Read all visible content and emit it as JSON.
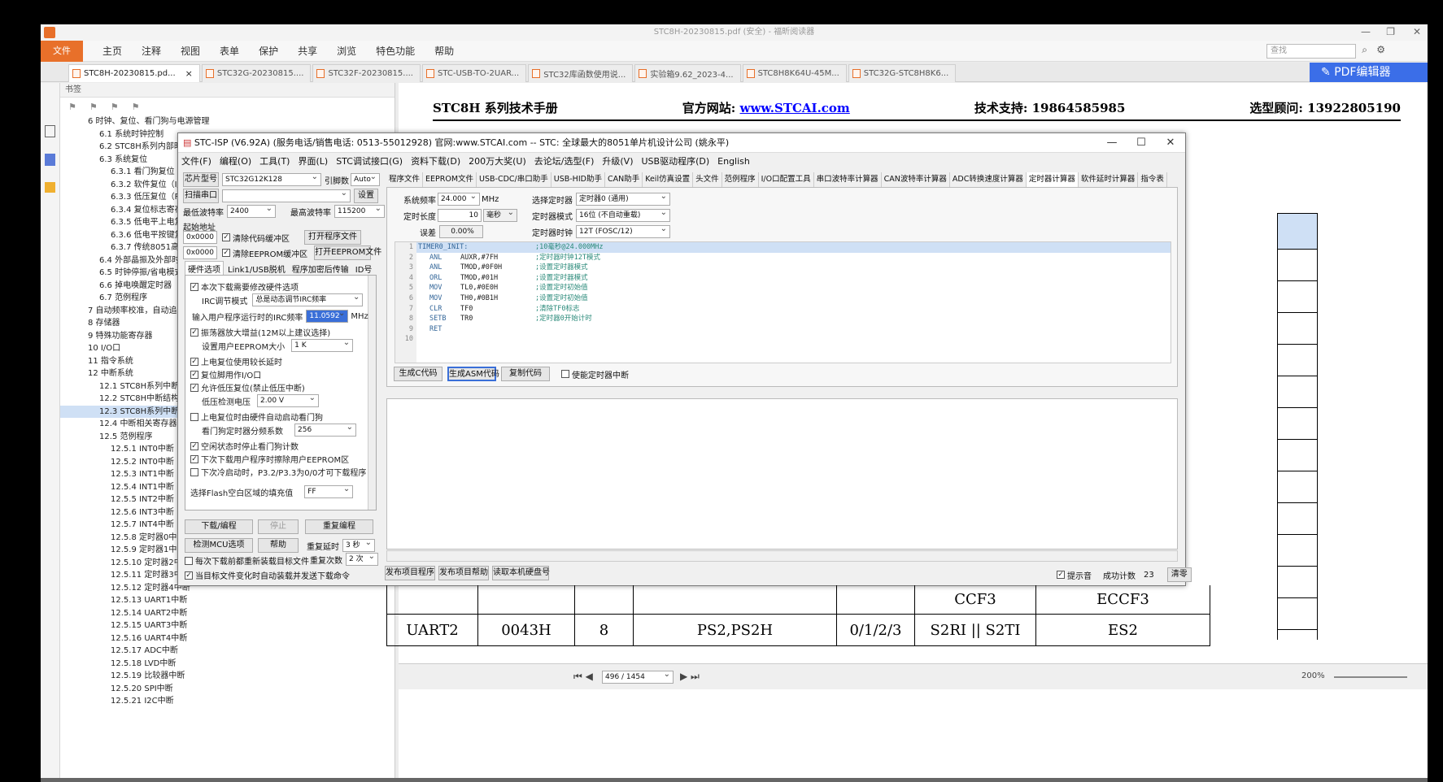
{
  "pdf": {
    "window_title": "STC8H-20230815.pdf (安全) - 福昕阅读器",
    "file_tab": "文件",
    "menu": [
      "主页",
      "注释",
      "视图",
      "表单",
      "保护",
      "共享",
      "浏览",
      "特色功能",
      "帮助"
    ],
    "search_placeholder": "查找",
    "pdf_editor": "PDF编辑器",
    "tabs": [
      "STC8H-20230815.pd...",
      "STC32G-20230815....",
      "STC32F-20230815....",
      "STC-USB-TO-2UAR...",
      "STC32库函数使用说...",
      "实验箱9.62_2023-4...",
      "STC8H8K64U-45M...",
      "STC32G-STC8H8K6..."
    ],
    "bookmarks_label": "书签",
    "tree": [
      "6 时钟、复位、看门狗与电源管理",
      "6.1 系统时钟控制",
      "6.2 STC8H系列内部时",
      "6.3 系统复位",
      "6.3.1 看门狗复位（",
      "6.3.2 软件复位（I/A",
      "6.3.3 低压复位（R",
      "6.3.4 复位标志寄存",
      "6.3.5 低电平上电复",
      "6.3.6 低电平按键复",
      "6.3.7 传统8051高电",
      "6.4 外部晶振及外部时",
      "6.5 时钟停振/省电模式",
      "6.6 掉电唤醒定时器",
      "6.7 范例程序",
      "7 自动频率校准，自动追频",
      "8 存储器",
      "9 特殊功能寄存器",
      "10 I/O口",
      "11 指令系统",
      "12 中断系统",
      "12.1 STC8H系列中断源",
      "12.2 STC8H中断结构图",
      "12.3 STC8H系列中断列",
      "12.4 中断相关寄存器",
      "12.5 范例程序",
      "12.5.1 INT0中断（上",
      "12.5.2 INT0中断（下",
      "12.5.3 INT1中断（上",
      "12.5.4 INT1中断（下",
      "12.5.5 INT2中断（下",
      "12.5.6 INT3中断（下",
      "12.5.7 INT4中断（下",
      "12.5.8 定时器0中断",
      "12.5.9 定时器1中断",
      "12.5.10 定时器2中断",
      "12.5.11 定时器3中断",
      "12.5.12 定时器4中断",
      "12.5.13 UART1中断",
      "12.5.14 UART2中断",
      "12.5.15 UART3中断",
      "12.5.16 UART4中断",
      "12.5.17 ADC中断",
      "12.5.18 LVD中断",
      "12.5.19 比较器中断",
      "12.5.20 SPI中断",
      "12.5.21 I2C中断"
    ],
    "doc_header": {
      "title": "STC8H 系列技术手册",
      "site_label": "官方网站: ",
      "site": "www.STCAI.com",
      "support": "技术支持: 19864585985",
      "advisor": "选型顾问: 13922805190"
    },
    "table": {
      "r1": [
        "CCF3",
        "ECCF3"
      ],
      "r2": [
        "UART2",
        "0043H",
        "8",
        "PS2,PS2H",
        "0/1/2/3",
        "S2RI || S2TI",
        "ES2"
      ]
    },
    "page": "496 / 1454",
    "zoom": "200%"
  },
  "isp": {
    "title": "STC-ISP (V6.92A) (服务电话/销售电话: 0513-55012928) 官网:www.STCAI.com  -- STC: 全球最大的8051单片机设计公司 (姚永平)",
    "menu": [
      "文件(F)",
      "编程(O)",
      "工具(T)",
      "界面(L)",
      "STC调试接口(G)",
      "资料下载(D)",
      "200万大奖(U)",
      "去论坛/选型(F)",
      "升级(V)",
      "USB驱动程序(D)",
      "English"
    ],
    "chip_label": "芯片型号",
    "chip": "STC32G12K128",
    "pins_label": "引脚数",
    "pins": "Auto",
    "scan_btn": "扫描串口",
    "settings_btn": "设置",
    "min_baud_label": "最低波特率",
    "min_baud": "2400",
    "max_baud_label": "最高波特率",
    "max_baud": "115200",
    "start_addr_label": "起始地址",
    "addr1": "0x0000",
    "clear_code": "清除代码缓冲区",
    "open_prog": "打开程序文件",
    "addr2": "0x0000",
    "clear_eeprom": "清除EEPROM缓冲区",
    "open_eeprom": "打开EEPROM文件",
    "left_tabs": [
      "硬件选项",
      "Link1/USB脱机",
      "程序加密后传输",
      "ID号"
    ],
    "opt_modify": "本次下载需要修改硬件选项",
    "irc_mode_label": "IRC调节模式",
    "irc_mode": "总是动态调节IRC频率",
    "freq_label": "输入用户程序运行时的IRC频率",
    "freq": "11.0592",
    "freq_unit": "MHz",
    "osc_gain": "振荡器放大增益(12M以上建议选择)",
    "eeprom_size_label": "设置用户EEPROM大小",
    "eeprom_size": "1  K",
    "long_delay": "上电复位使用较长延时",
    "reset_io": "复位脚用作I/O口",
    "lvr": "允许低压复位(禁止低压中断)",
    "lvd_label": "低压检测电压",
    "lvd": "2.00 V",
    "wdt_auto": "上电复位时由硬件自动启动看门狗",
    "wdt_div_label": "看门狗定时器分频系数",
    "wdt_div": "256",
    "idle_wdt": "空闲状态时停止看门狗计数",
    "erase_eeprom": "下次下载用户程序时擦除用户EEPROM区",
    "p32": "下次冷启动时，P3.2/P3.3为0/0才可下载程序",
    "fill_label": "选择Flash空白区域的填充值",
    "fill": "FF",
    "download_btn": "下载/编程",
    "stop_btn": "停止",
    "reprogram_btn": "重复编程",
    "detect_btn": "检测MCU选项",
    "help_btn": "帮助",
    "repeat_delay_label": "重复延时",
    "repeat_delay": "3 秒",
    "repeat_count_label": "重复次数",
    "repeat_count": "2 次",
    "reload_each": "每次下载前都重新装载目标文件",
    "auto_send": "当目标文件变化时自动装载并发送下载命令",
    "right_tabs": [
      "程序文件",
      "EEPROM文件",
      "USB-CDC/串口助手",
      "USB-HID助手",
      "CAN助手",
      "Keil仿真设置",
      "头文件",
      "范例程序",
      "I/O口配置工具",
      "串口波特率计算器",
      "CAN波特率计算器",
      "ADC转换速度计算器",
      "定时器计算器",
      "软件延时计算器",
      "指令表"
    ],
    "sysfreq_label": "系统频率",
    "sysfreq": "24.000",
    "sysfreq_unit": "MHz",
    "timer_sel_label": "选择定时器",
    "timer_sel": "定时器0 (通用)",
    "len_label": "定时长度",
    "len": "10",
    "len_unit": "毫秒",
    "mode_label": "定时器模式",
    "mode": "16位 (不自动重载)",
    "err_label": "误差",
    "err": "0.00%",
    "clk_label": "定时器时钟",
    "clk": "12T (FOSC/12)",
    "line_numbers": [
      "1",
      "2",
      "3",
      "4",
      "5",
      "6",
      "7",
      "8",
      "9",
      "10"
    ],
    "code": [
      {
        "k": "TIMER0_INIT:",
        "o": "",
        "c": ";10毫秒@24.000MHz"
      },
      {
        "k": "ANL",
        "o": "AUXR,#7FH",
        "c": ";定时器时钟12T模式"
      },
      {
        "k": "ANL",
        "o": "TMOD,#0F0H",
        "c": ";设置定时器模式"
      },
      {
        "k": "ORL",
        "o": "TMOD,#01H",
        "c": ";设置定时器模式"
      },
      {
        "k": "MOV",
        "o": "TL0,#0E0H",
        "c": ";设置定时初始值"
      },
      {
        "k": "MOV",
        "o": "TH0,#0B1H",
        "c": ";设置定时初始值"
      },
      {
        "k": "CLR",
        "o": "TF0",
        "c": ";清除TF0标志"
      },
      {
        "k": "SETB",
        "o": "TR0",
        "c": ";定时器0开始计时"
      },
      {
        "k": "RET",
        "o": "",
        "c": ""
      }
    ],
    "gen_c": "生成C代码",
    "gen_asm": "生成ASM代码",
    "copy_code": "复制代码",
    "enable_int": "使能定时器中断",
    "publish": "发布项目程序",
    "publish_help": "发布项目帮助",
    "read_disk": "读取本机硬盘号",
    "beep": "提示音",
    "success_label": "成功计数",
    "success": "23",
    "clear": "清零"
  }
}
